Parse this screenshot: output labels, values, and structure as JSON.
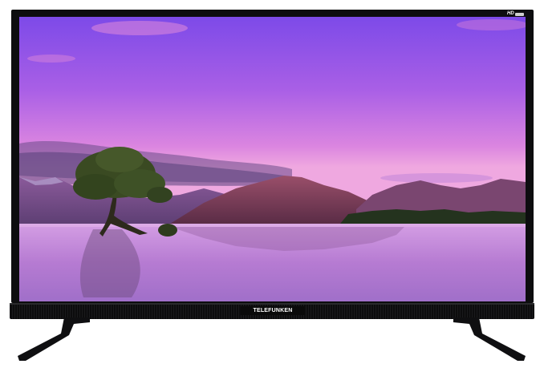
{
  "brand": {
    "name": "TELEFUNKEN"
  },
  "badge": {
    "label": "HD",
    "sublabel_icon": "hd-ready-tag"
  },
  "image": {
    "subject": "tv-product-photo",
    "screen_content_icon": "lake-sunset-scene"
  },
  "colors": {
    "bezel": "#0d0d0f",
    "sky_top": "#8a4ee6",
    "sky_bottom": "#e597df",
    "mountains": "#7a3c56",
    "water": "#c68cdc"
  }
}
